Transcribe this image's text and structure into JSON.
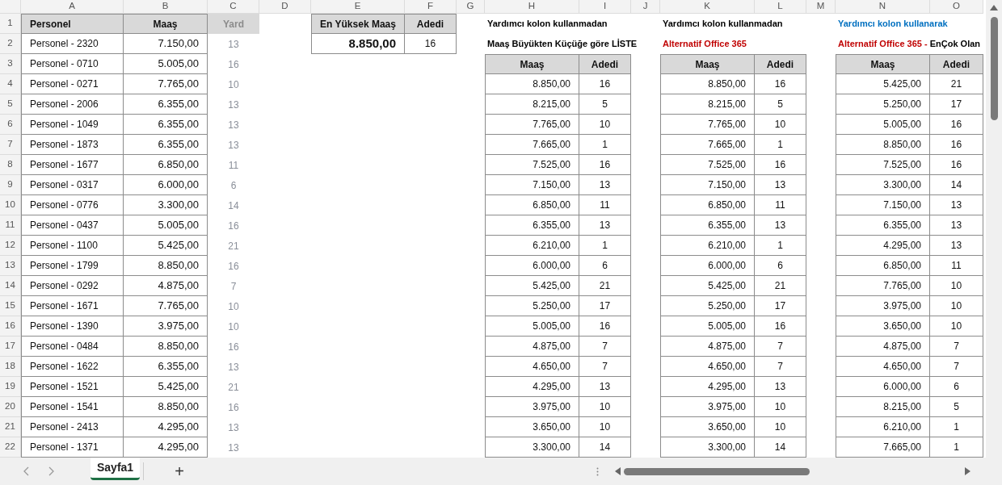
{
  "column_headers": [
    "A",
    "B",
    "C",
    "D",
    "E",
    "F",
    "G",
    "H",
    "I",
    "J",
    "K",
    "L",
    "M",
    "N",
    "O"
  ],
  "row_headers": [
    "1",
    "2",
    "3",
    "4",
    "5",
    "6",
    "7",
    "8",
    "9",
    "10",
    "11",
    "12",
    "13",
    "14",
    "15",
    "16",
    "17",
    "18",
    "19",
    "20",
    "21",
    "22"
  ],
  "personnel": {
    "columns": [
      "Personel",
      "Maaş",
      "Yard"
    ],
    "rows": [
      [
        "Personel - 2320",
        "7.150,00",
        "13"
      ],
      [
        "Personel - 0710",
        "5.005,00",
        "16"
      ],
      [
        "Personel - 0271",
        "7.765,00",
        "10"
      ],
      [
        "Personel - 2006",
        "6.355,00",
        "13"
      ],
      [
        "Personel - 1049",
        "6.355,00",
        "13"
      ],
      [
        "Personel - 1873",
        "6.355,00",
        "13"
      ],
      [
        "Personel - 1677",
        "6.850,00",
        "11"
      ],
      [
        "Personel - 0317",
        "6.000,00",
        "6"
      ],
      [
        "Personel - 0776",
        "3.300,00",
        "14"
      ],
      [
        "Personel - 0437",
        "5.005,00",
        "16"
      ],
      [
        "Personel - 1100",
        "5.425,00",
        "21"
      ],
      [
        "Personel - 1799",
        "8.850,00",
        "16"
      ],
      [
        "Personel - 0292",
        "4.875,00",
        "7"
      ],
      [
        "Personel - 1671",
        "7.765,00",
        "10"
      ],
      [
        "Personel - 1390",
        "3.975,00",
        "10"
      ],
      [
        "Personel - 0484",
        "8.850,00",
        "16"
      ],
      [
        "Personel - 1622",
        "6.355,00",
        "13"
      ],
      [
        "Personel - 1521",
        "5.425,00",
        "21"
      ],
      [
        "Personel - 1541",
        "8.850,00",
        "16"
      ],
      [
        "Personel - 2413",
        "4.295,00",
        "13"
      ],
      [
        "Personel - 1371",
        "4.295,00",
        "13"
      ]
    ]
  },
  "summary": {
    "columns": [
      "En Yüksek Maaş",
      "Adedi"
    ],
    "values": [
      "8.850,00",
      "16"
    ]
  },
  "lists": [
    {
      "note": {
        "text": "Yardımcı kolon kullanmadan",
        "color": "#000000"
      },
      "title": [
        {
          "text": "Maaş Büyükten Küçüğe göre LİSTE",
          "color": "#000000"
        }
      ],
      "columns": [
        "Maaş",
        "Adedi"
      ],
      "rows": [
        [
          "8.850,00",
          "16"
        ],
        [
          "8.215,00",
          "5"
        ],
        [
          "7.765,00",
          "10"
        ],
        [
          "7.665,00",
          "1"
        ],
        [
          "7.525,00",
          "16"
        ],
        [
          "7.150,00",
          "13"
        ],
        [
          "6.850,00",
          "11"
        ],
        [
          "6.355,00",
          "13"
        ],
        [
          "6.210,00",
          "1"
        ],
        [
          "6.000,00",
          "6"
        ],
        [
          "5.425,00",
          "21"
        ],
        [
          "5.250,00",
          "17"
        ],
        [
          "5.005,00",
          "16"
        ],
        [
          "4.875,00",
          "7"
        ],
        [
          "4.650,00",
          "7"
        ],
        [
          "4.295,00",
          "13"
        ],
        [
          "3.975,00",
          "10"
        ],
        [
          "3.650,00",
          "10"
        ],
        [
          "3.300,00",
          "14"
        ]
      ]
    },
    {
      "note": {
        "text": "Yardımcı kolon kullanmadan",
        "color": "#000000"
      },
      "title": [
        {
          "text": "Alternatif Office 365",
          "color": "#c00000"
        }
      ],
      "columns": [
        "Maaş",
        "Adedi"
      ],
      "rows": [
        [
          "8.850,00",
          "16"
        ],
        [
          "8.215,00",
          "5"
        ],
        [
          "7.765,00",
          "10"
        ],
        [
          "7.665,00",
          "1"
        ],
        [
          "7.525,00",
          "16"
        ],
        [
          "7.150,00",
          "13"
        ],
        [
          "6.850,00",
          "11"
        ],
        [
          "6.355,00",
          "13"
        ],
        [
          "6.210,00",
          "1"
        ],
        [
          "6.000,00",
          "6"
        ],
        [
          "5.425,00",
          "21"
        ],
        [
          "5.250,00",
          "17"
        ],
        [
          "5.005,00",
          "16"
        ],
        [
          "4.875,00",
          "7"
        ],
        [
          "4.650,00",
          "7"
        ],
        [
          "4.295,00",
          "13"
        ],
        [
          "3.975,00",
          "10"
        ],
        [
          "3.650,00",
          "10"
        ],
        [
          "3.300,00",
          "14"
        ]
      ]
    },
    {
      "note": {
        "text": "Yardımcı kolon kullanarak",
        "color": "#0070c0"
      },
      "title": [
        {
          "text": "Alternatif Office 365 -",
          "color": "#c00000"
        },
        {
          "text": " EnÇok Olan",
          "color": "#000000"
        }
      ],
      "columns": [
        "Maaş",
        "Adedi"
      ],
      "rows": [
        [
          "5.425,00",
          "21"
        ],
        [
          "5.250,00",
          "17"
        ],
        [
          "5.005,00",
          "16"
        ],
        [
          "8.850,00",
          "16"
        ],
        [
          "7.525,00",
          "16"
        ],
        [
          "3.300,00",
          "14"
        ],
        [
          "7.150,00",
          "13"
        ],
        [
          "6.355,00",
          "13"
        ],
        [
          "4.295,00",
          "13"
        ],
        [
          "6.850,00",
          "11"
        ],
        [
          "7.765,00",
          "10"
        ],
        [
          "3.975,00",
          "10"
        ],
        [
          "3.650,00",
          "10"
        ],
        [
          "4.875,00",
          "7"
        ],
        [
          "4.650,00",
          "7"
        ],
        [
          "6.000,00",
          "6"
        ],
        [
          "8.215,00",
          "5"
        ],
        [
          "6.210,00",
          "1"
        ],
        [
          "7.665,00",
          "1"
        ]
      ]
    }
  ],
  "sheet_tabs": [
    {
      "label": "Sayfa1",
      "selected": true
    }
  ],
  "add_sheet": "+"
}
